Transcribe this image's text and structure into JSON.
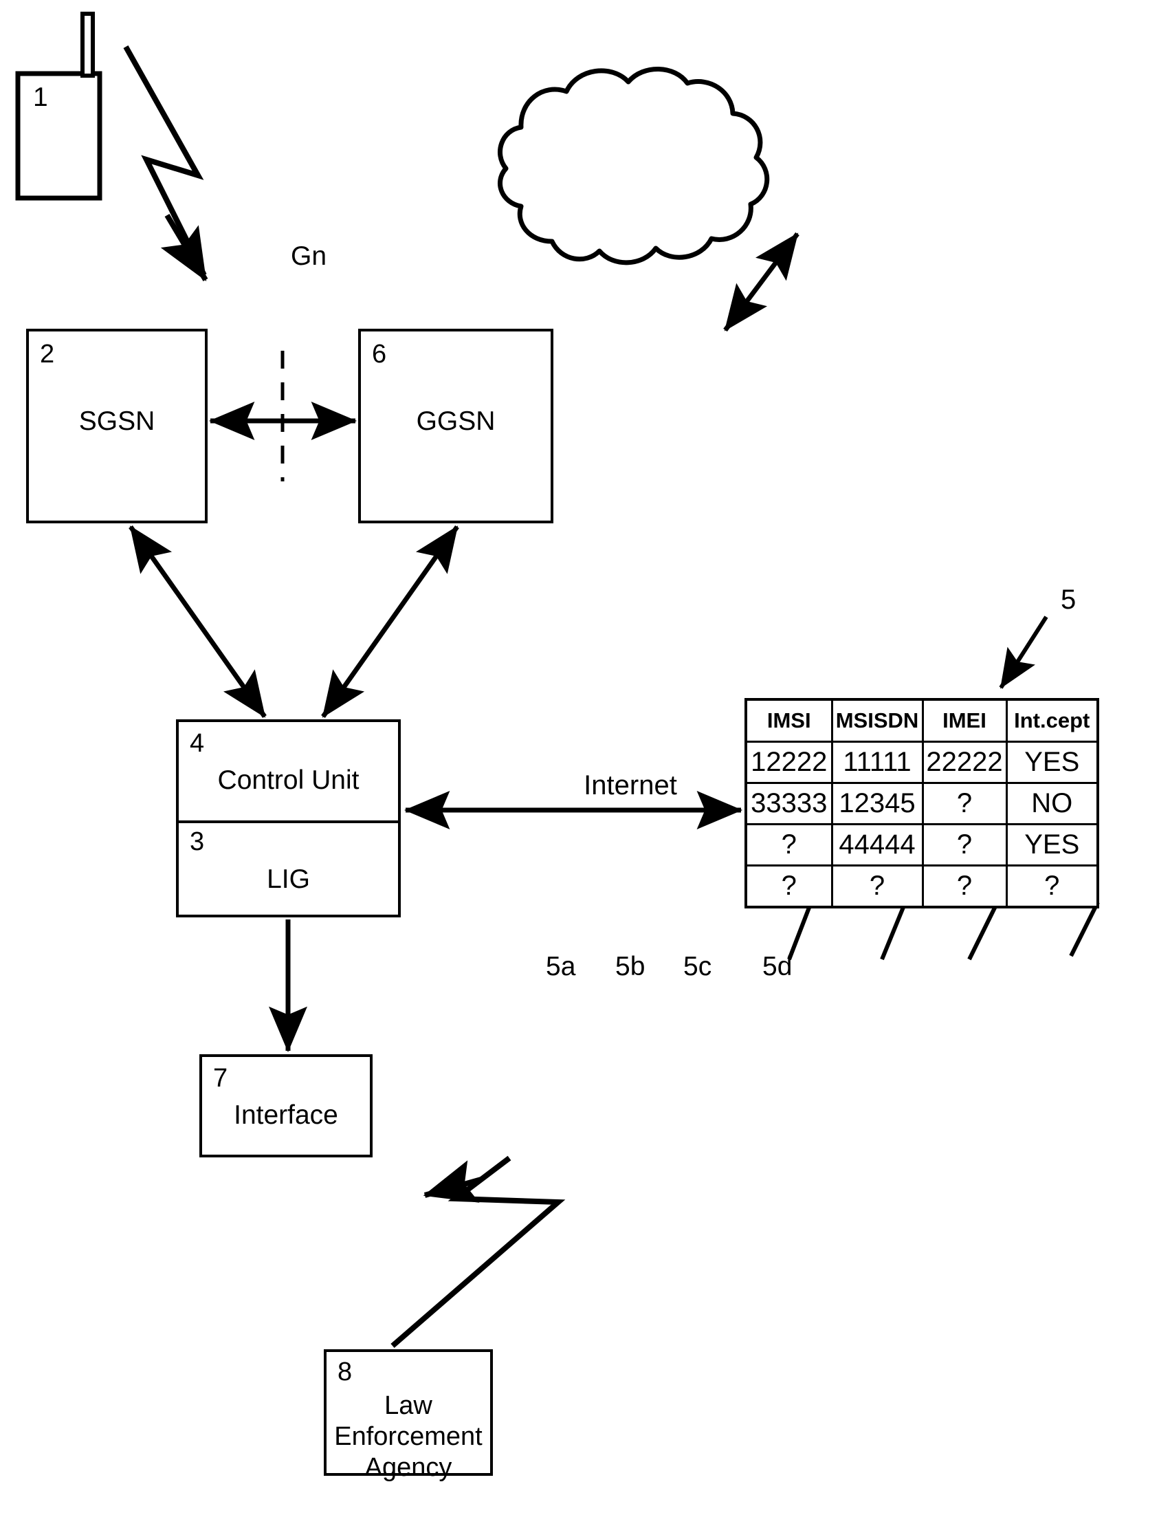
{
  "figure": {
    "title": "Lawful interception network diagram",
    "stroke_color": "#000000",
    "background_color": "#ffffff"
  },
  "nodes": {
    "mobile": {
      "ref": "1",
      "label": ""
    },
    "sgsn": {
      "ref": "2",
      "label": "SGSN"
    },
    "lig": {
      "ref": "3",
      "label": "LIG"
    },
    "control_unit": {
      "ref": "4",
      "label": "Control Unit"
    },
    "table": {
      "ref": "5"
    },
    "ggsn": {
      "ref": "6",
      "label": "GGSN"
    },
    "interface": {
      "ref": "7",
      "label": "Interface"
    },
    "lea": {
      "ref": "8",
      "label_line1": "Law",
      "label_line2": "Enforcement",
      "label_line3": "Agency"
    },
    "internet": {
      "label": "Internet"
    }
  },
  "links": {
    "gn_label": "Gn"
  },
  "column_refs": {
    "imsi": "5a",
    "msisdn": "5b",
    "imei": "5c",
    "intercept": "5d"
  },
  "chart_data": {
    "type": "table",
    "title": "Interception subscriber table",
    "columns": [
      "IMSI",
      "MSISDN",
      "IMEI",
      "Int.cept"
    ],
    "rows": [
      [
        "12222",
        "11111",
        "22222",
        "YES"
      ],
      [
        "33333",
        "12345",
        "?",
        "NO"
      ],
      [
        "?",
        "44444",
        "?",
        "YES"
      ],
      [
        "?",
        "?",
        "?",
        "?"
      ]
    ],
    "column_refs": [
      "5a",
      "5b",
      "5c",
      "5d"
    ]
  }
}
